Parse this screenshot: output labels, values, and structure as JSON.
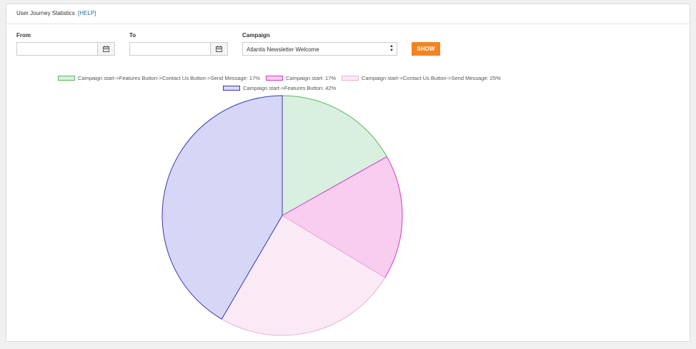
{
  "header": {
    "title": "User Journey Statistics",
    "help": "[HELP]"
  },
  "filters": {
    "from_label": "From",
    "to_label": "To",
    "campaign_label": "Campaign",
    "campaign_value": "Atlantis Newsletter Welcome",
    "show_label": "SHOW"
  },
  "icons": {
    "calendar": "calendar-icon",
    "select_arrows": "select-arrows-icon"
  },
  "chart_data": {
    "type": "pie",
    "slices": [
      {
        "label": "Campaign start->Features Button->Contact Us Button->Send Message",
        "value": 17,
        "fill": "#d9efdf",
        "stroke": "#5cb85c"
      },
      {
        "label": "Campaign start",
        "value": 17,
        "fill": "#f8cdef",
        "stroke": "#d63ad0"
      },
      {
        "label": "Campaign start->Contact Us Button->Send Message",
        "value": 25,
        "fill": "#faeaf6",
        "stroke": "#e8b0d8"
      },
      {
        "label": "Campaign start->Features Button",
        "value": 42,
        "fill": "#d6d6f6",
        "stroke": "#3a3ab0"
      }
    ],
    "legend_texts": [
      "Campaign start->Features Button->Contact Us Button->Send Message: 17%",
      "Campaign start: 17%",
      "Campaign start->Contact Us Button->Send Message: 25%",
      "Campaign start->Features Button: 42%"
    ],
    "legend_position": "top"
  }
}
